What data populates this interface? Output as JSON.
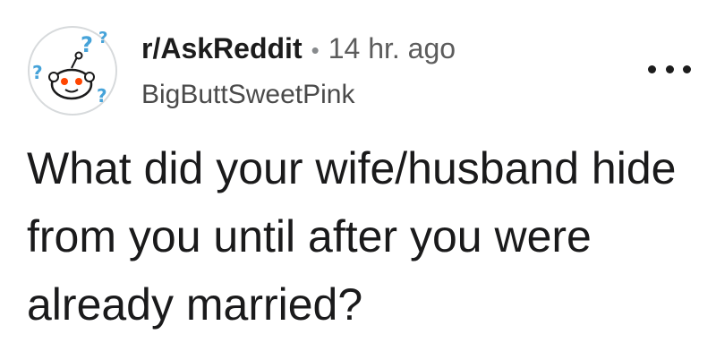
{
  "post": {
    "subreddit": "r/AskReddit",
    "separator": "•",
    "time_ago": "14 hr. ago",
    "username": "BigButtSweetPink",
    "title": "What did your wife/husband hide from you until after you were already married?",
    "avatar_icon": "askreddit-snoo-icon",
    "more_icon": "more-options-icon"
  },
  "colors": {
    "snoo_face": "#ffffff",
    "snoo_eyes": "#ff4500",
    "question_marks": "#46a3d9",
    "avatar_ring": "#d7dadc"
  }
}
